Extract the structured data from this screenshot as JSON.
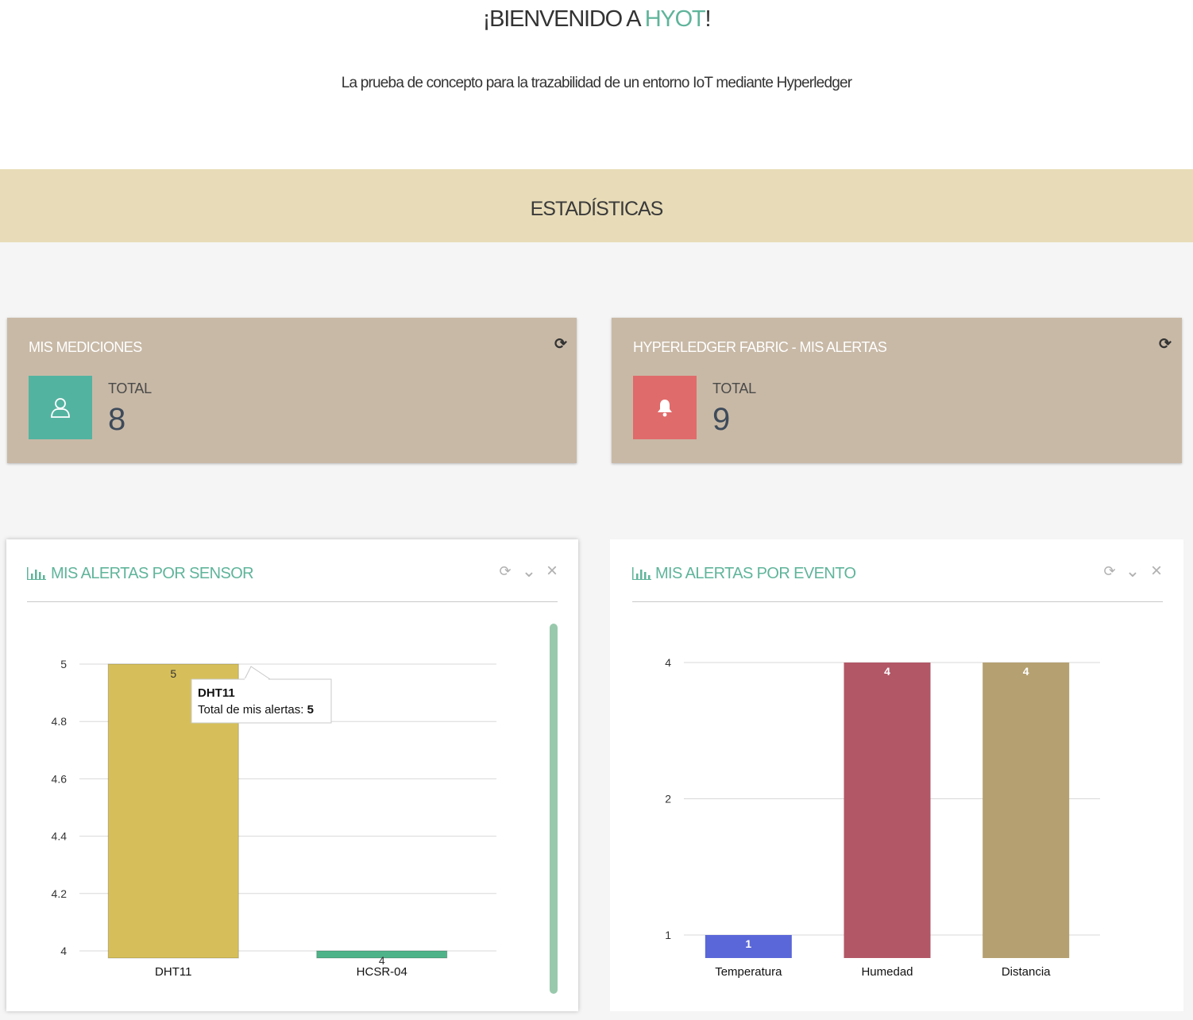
{
  "hero": {
    "title_prefix": "¡BIENVENIDO A ",
    "title_accent": "HYOT",
    "title_suffix": "!",
    "subtitle": "La prueba de concepto para la trazabilidad de un entorno IoT mediante Hyperledger"
  },
  "section": {
    "title": "ESTADÍSTICAS"
  },
  "cards": [
    {
      "title": "MIS MEDICIONES",
      "label": "TOTAL",
      "value": "8",
      "icon": "user-icon",
      "color": "#53b3a1"
    },
    {
      "title": "HYPERLEDGER FABRIC - MIS ALERTAS",
      "label": "TOTAL",
      "value": "9",
      "icon": "bell-icon",
      "color": "#e06b6b"
    }
  ],
  "panels": [
    {
      "title": "MIS ALERTAS POR SENSOR"
    },
    {
      "title": "MIS ALERTAS POR EVENTO"
    }
  ],
  "icons": {
    "refresh": "⟳",
    "collapse": "⌄",
    "close": "×"
  },
  "chart_data": [
    {
      "type": "bar",
      "title": "MIS ALERTAS POR SENSOR",
      "categories": [
        "DHT11",
        "HCSR-04"
      ],
      "values": [
        5,
        4
      ],
      "colors": [
        "#d6bf5a",
        "#4fb389"
      ],
      "ylim": [
        4,
        5
      ],
      "yticks": [
        "5",
        "4.8",
        "4.6",
        "4.4",
        "4.2",
        "4"
      ],
      "data_labels": [
        "5",
        "4"
      ],
      "tooltip": {
        "title": "DHT11",
        "text": "Total de mis alertas: ",
        "value": "5"
      }
    },
    {
      "type": "bar",
      "title": "MIS ALERTAS POR EVENTO",
      "categories": [
        "Temperatura",
        "Humedad",
        "Distancia"
      ],
      "values": [
        1,
        4,
        4
      ],
      "colors": [
        "#5a67d8",
        "#b25766",
        "#b5a071"
      ],
      "yscale": "log",
      "yticks": [
        "4",
        "2",
        "1"
      ],
      "data_labels": [
        "1",
        "4",
        "4"
      ]
    }
  ]
}
